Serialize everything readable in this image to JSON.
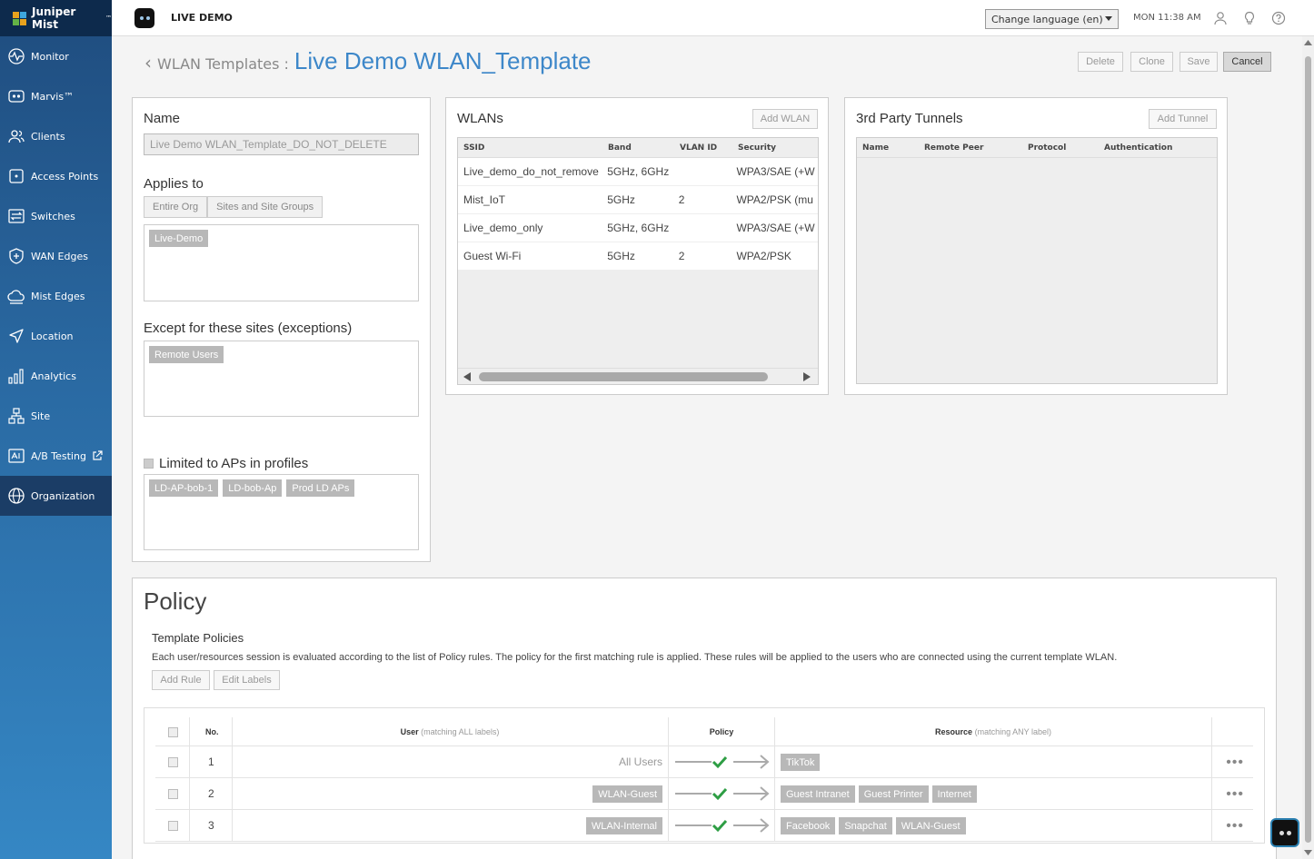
{
  "app": {
    "brand": "Juniper Mist",
    "brand_mark": "™",
    "live_demo": "LIVE DEMO"
  },
  "sidebar": {
    "items": [
      {
        "label": "Monitor",
        "icon": "pulse-icon"
      },
      {
        "label": "Marvis™",
        "icon": "marvis-icon"
      },
      {
        "label": "Clients",
        "icon": "clients-icon"
      },
      {
        "label": "Access Points",
        "icon": "access-point-icon"
      },
      {
        "label": "Switches",
        "icon": "switch-icon"
      },
      {
        "label": "WAN Edges",
        "icon": "wan-edge-icon"
      },
      {
        "label": "Mist Edges",
        "icon": "cloud-icon"
      },
      {
        "label": "Location",
        "icon": "location-arrow-icon"
      },
      {
        "label": "Analytics",
        "icon": "bar-chart-icon"
      },
      {
        "label": "Site",
        "icon": "site-icon"
      },
      {
        "label": "A/B Testing",
        "icon": "ab-testing-icon"
      },
      {
        "label": "Organization",
        "icon": "globe-icon"
      }
    ],
    "active": "Organization"
  },
  "topbar": {
    "language": "Change language (en)",
    "clock": "MON 11:38 AM"
  },
  "header": {
    "crumb": "WLAN Templates :",
    "title": "Live Demo WLAN_Template"
  },
  "actions": {
    "delete": "Delete",
    "clone": "Clone",
    "save": "Save",
    "cancel": "Cancel"
  },
  "template": {
    "name_label": "Name",
    "name_value": "Live Demo WLAN_Template_DO_NOT_DELETE",
    "applies_label": "Applies to",
    "applies_opts": [
      "Entire Org",
      "Sites and Site Groups"
    ],
    "applies_tags": [
      "Live-Demo"
    ],
    "except_label": "Except for these sites (exceptions)",
    "except_tags": [
      "Remote Users"
    ],
    "limited_label": "Limited to APs in profiles",
    "limited_tags": [
      "LD-AP-bob-1",
      "LD-bob-Ap",
      "Prod LD APs"
    ]
  },
  "wlans": {
    "title": "WLANs",
    "add": "Add WLAN",
    "columns": [
      "SSID",
      "Band",
      "VLAN ID",
      "Security"
    ],
    "rows": [
      [
        "Live_demo_do_not_remove",
        "5GHz, 6GHz",
        "",
        "WPA3/SAE (+W"
      ],
      [
        "Mist_IoT",
        "5GHz",
        "2",
        "WPA2/PSK (mu"
      ],
      [
        "Live_demo_only",
        "5GHz, 6GHz",
        "",
        "WPA3/SAE (+W"
      ],
      [
        "Guest Wi-Fi",
        "5GHz",
        "2",
        "WPA2/PSK"
      ]
    ]
  },
  "tunnels": {
    "title": "3rd Party Tunnels",
    "add": "Add Tunnel",
    "columns": [
      "Name",
      "Remote Peer",
      "Protocol",
      "Authentication"
    ]
  },
  "policy": {
    "title": "Policy",
    "subtitle": "Template Policies",
    "description": "Each user/resources session is evaluated according to the list of Policy rules. The policy for the first matching rule is applied. These rules will be applied to the users who are connected using the current template WLAN.",
    "add_rule": "Add Rule",
    "edit_labels": "Edit Labels",
    "col_no": "No.",
    "col_user": "User",
    "col_user_note": "(matching ALL labels)",
    "col_policy": "Policy",
    "col_resource": "Resource",
    "col_resource_note": "(matching ANY label)",
    "rules": [
      {
        "no": "1",
        "user": "All Users",
        "user_tag": false,
        "resources": [
          "TikTok"
        ]
      },
      {
        "no": "2",
        "user": "WLAN-Guest",
        "user_tag": true,
        "resources": [
          "Guest Intranet",
          "Guest Printer",
          "Internet"
        ]
      },
      {
        "no": "3",
        "user": "WLAN-Internal",
        "user_tag": true,
        "resources": [
          "Facebook",
          "Snapchat",
          "WLAN-Guest"
        ]
      }
    ]
  },
  "colors": {
    "accent": "#3d87c9",
    "sidebar_dark": "#0d2a4c",
    "allow_check": "#2e9e44"
  }
}
